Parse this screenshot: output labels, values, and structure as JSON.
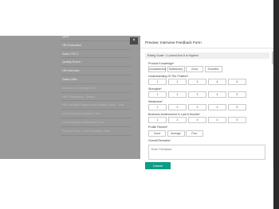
{
  "background": {
    "close_label": "×",
    "items": [
      "Q&A",
      "HR Evaluation",
      "Sales TECT",
      "Quality Event ↑",
      "HR interview",
      "Sales Offer",
      "Incidence Learning Event",
      "HR Onboarding - Salary",
      "HSE Incident Report and Vehicle Check - Edit",
      "Lead Contact Adoption Form",
      "Lead Meeting Notification Form",
      "Product Form - Lost Products - Edit"
    ]
  },
  "modal": {
    "title": "Preview: Interview Feedback Form",
    "rating_note": "Rating Scale: 1 Lowest And 5 is Highest",
    "questions": [
      {
        "label": "Product Knowledge*",
        "options": [
          "Unsatisfactory",
          "Satisfactory",
          "Good",
          "Excellent"
        ]
      },
      {
        "label": "Understanding Of The Position*",
        "options": [
          "1",
          "2",
          "3",
          "4",
          "5"
        ]
      },
      {
        "label": "Strengths*",
        "options": [
          "1",
          "2",
          "3",
          "4",
          "5"
        ]
      },
      {
        "label": "Weakness*",
        "options": [
          "1",
          "2",
          "3",
          "4",
          "5"
        ]
      },
      {
        "label": "Business Achievement in Last 6 Months*",
        "options": [
          "1",
          "2",
          "3",
          "4",
          "5"
        ]
      },
      {
        "label": "Profile Fitment*",
        "options": [
          "Good",
          "Average",
          "Poor"
        ]
      }
    ],
    "remarks_label": "Overall Remarks*",
    "remarks_placeholder": "Enter Feedback",
    "cancel_label": "Cancel"
  },
  "colors": {
    "accent": "#0b9d86",
    "overlay": "#9a9a9a"
  }
}
